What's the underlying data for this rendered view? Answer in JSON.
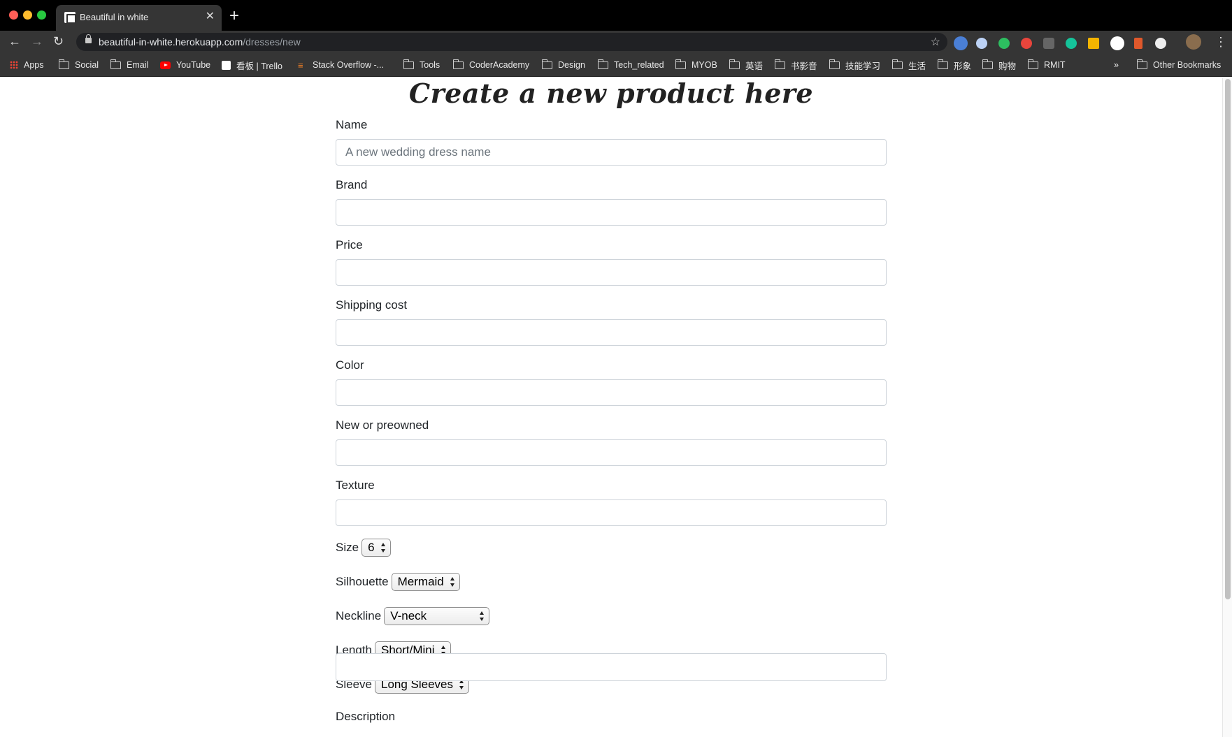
{
  "browser": {
    "tab_title": "Beautiful in white",
    "url_host": "beautiful-in-white.herokuapp.com",
    "url_path": "/dresses/new",
    "bookmarks": [
      "Apps",
      "Social",
      "Email",
      "YouTube",
      "看板 | Trello",
      "Stack Overflow -...",
      "Tools",
      "CoderAcademy",
      "Design",
      "Tech_related",
      "MYOB",
      "英语",
      "书影音",
      "技能学习",
      "生活",
      "形象",
      "购物",
      "RMIT"
    ],
    "overflow_label": "»",
    "other_bookmarks": "Other Bookmarks"
  },
  "form": {
    "heading": "Create a new product here",
    "name": {
      "label": "Name",
      "placeholder": "A new wedding dress name"
    },
    "brand": {
      "label": "Brand"
    },
    "price": {
      "label": "Price"
    },
    "shipping": {
      "label": "Shipping cost"
    },
    "color": {
      "label": "Color"
    },
    "condition": {
      "label": "New or preowned"
    },
    "texture": {
      "label": "Texture"
    },
    "size": {
      "label": "Size",
      "value": "6"
    },
    "silhouette": {
      "label": "Silhouette",
      "value": "Mermaid"
    },
    "neckline": {
      "label": "Neckline",
      "value": "V-neck"
    },
    "length": {
      "label": "Length",
      "value": "Short/Mini"
    },
    "sleeve": {
      "label": "Sleeve",
      "value": "Long Sleeves"
    },
    "description": {
      "label": "Description"
    }
  }
}
